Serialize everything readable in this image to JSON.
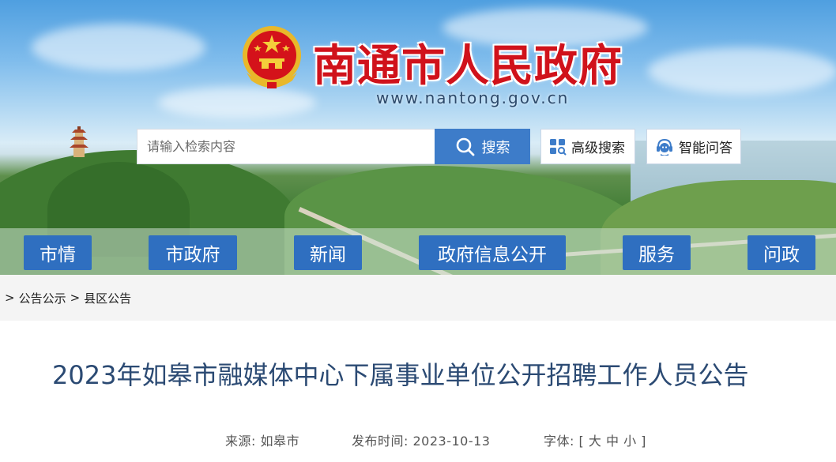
{
  "site": {
    "title": "南通市人民政府",
    "url": "www.nantong.gov.cn"
  },
  "search": {
    "placeholder": "请输入检索内容",
    "button_label": "搜索",
    "advanced_label": "高级搜索",
    "qa_label": "智能问答"
  },
  "nav": {
    "items": [
      {
        "label": "市情"
      },
      {
        "label": "市政府"
      },
      {
        "label": "新闻"
      },
      {
        "label": "政府信息公开"
      },
      {
        "label": "服务"
      },
      {
        "label": "问政"
      }
    ]
  },
  "breadcrumb": {
    "sep1": ">",
    "item1": "公告公示",
    "sep2": ">",
    "item2": "县区公告"
  },
  "article": {
    "title": "2023年如皋市融媒体中心下属事业单位公开招聘工作人员公告",
    "source_label": "来源:",
    "source_value": "如皋市",
    "date_label": "发布时间:",
    "date_value": "2023-10-13",
    "font_label": "字体:",
    "font_open": "[",
    "font_large": "大",
    "font_medium": "中",
    "font_small": "小",
    "font_close": "]"
  },
  "colors": {
    "title_red": "#d0121b",
    "nav_blue": "#2f6fc0",
    "search_blue": "#3d7cc9",
    "article_title": "#2b4a73"
  }
}
